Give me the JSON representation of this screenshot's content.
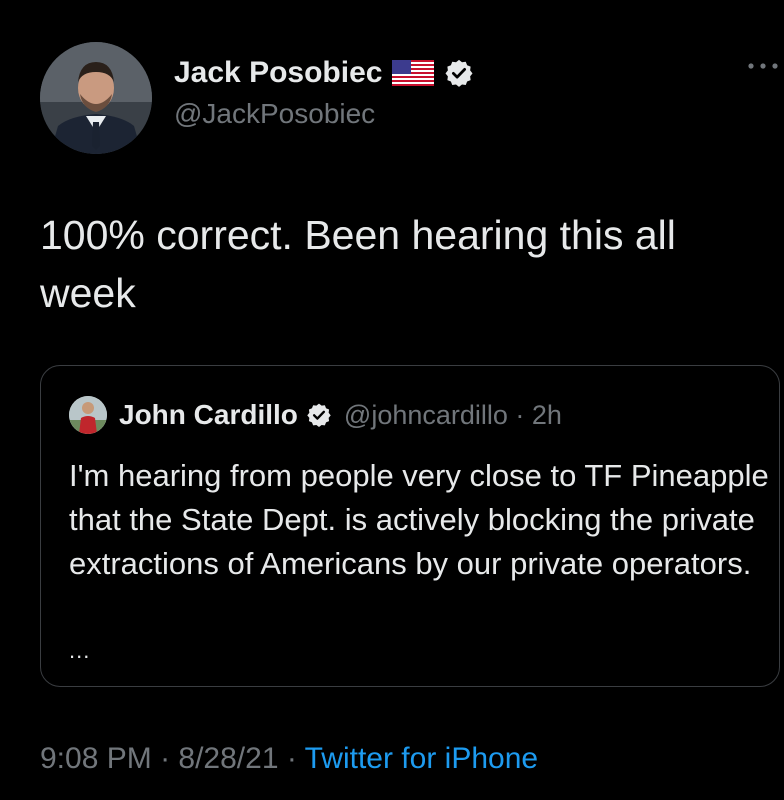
{
  "tweet": {
    "author_name": "Jack Posobiec",
    "author_handle": "@JackPosobiec",
    "text": "100% correct. Been hearing this all week",
    "time": "9:08 PM",
    "date": "8/28/21",
    "source": "Twitter for iPhone",
    "separator": " · "
  },
  "quoted_tweet": {
    "author_name": "John Cardillo",
    "author_handle": "@johncardillo",
    "age": "2h",
    "text": "I'm hearing from people very close to TF Pineapple that the State Dept. is actively blocking the private extractions of Americans by our private operators.",
    "ellipsis": "..."
  },
  "colors": {
    "background": "#000000",
    "text": "#e7e9ea",
    "secondary": "#71767b",
    "link": "#1d9bf0",
    "border": "#3a3d41"
  },
  "icons": {
    "flag": "us-flag-icon",
    "verified": "verified-badge-icon",
    "more": "more-dots-icon"
  }
}
